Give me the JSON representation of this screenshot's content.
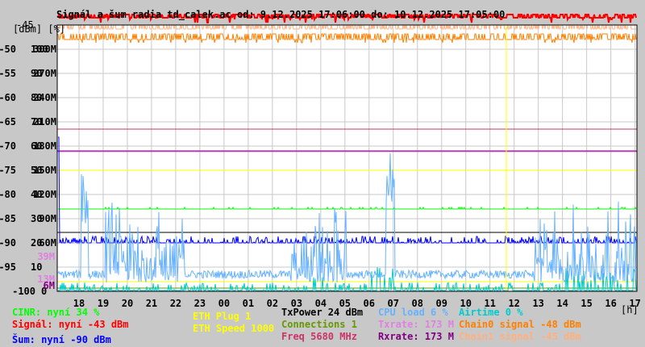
{
  "chart_data": {
    "type": "line",
    "title": "Signál a šum radia td_calek.ac od: 9.12.2025 17:06:00 do: 10.12.2025 17:05:00",
    "ylabel": "[dBm] [%]",
    "y_top_label": "-45",
    "xunit": "[h]",
    "xlim": [
      17.1,
      41.08
    ],
    "x_ticks": [
      "18",
      "19",
      "20",
      "21",
      "22",
      "23",
      "00",
      "01",
      "02",
      "03",
      "04",
      "05",
      "06",
      "07",
      "08",
      "09",
      "10",
      "11",
      "12",
      "13",
      "14",
      "15",
      "16",
      "17"
    ],
    "y_axes": {
      "dbm": {
        "range": [
          -100,
          -45
        ],
        "ticks": [
          "-50",
          "-55",
          "-60",
          "-65",
          "-70",
          "-75",
          "-80",
          "-85",
          "-90",
          "-95",
          "-100"
        ]
      },
      "percent": {
        "range": [
          0,
          110
        ],
        "ticks": [
          "100",
          "90",
          "80",
          "70",
          "60",
          "50",
          "40",
          "30",
          "20",
          "10",
          "0"
        ]
      },
      "rate": {
        "range": [
          0,
          330
        ],
        "ticks": [
          "300M",
          "270M",
          "240M",
          "210M",
          "180M",
          "150M",
          "120M",
          "90M",
          "60M"
        ]
      }
    },
    "extra_rate_labels": [
      {
        "text": "39M",
        "color": "#e080e0"
      },
      {
        "text": "13M",
        "color": "#e080e0"
      },
      {
        "text": "6M",
        "color": "#800080"
      }
    ],
    "grid": true,
    "marker_hour": 11.75,
    "series": [
      {
        "name": "CINR",
        "current": 34,
        "unit": "%",
        "color": "#00ff00"
      },
      {
        "name": "Signál",
        "current": -43,
        "unit": "dBm",
        "color": "#ff0000"
      },
      {
        "name": "Šum",
        "current": -90,
        "unit": "dBm",
        "color": "#0000ff"
      },
      {
        "name": "ETH Plug",
        "current": 1,
        "color": "#ffff00"
      },
      {
        "name": "ETH Speed",
        "current": 1000,
        "color": "#ffff00"
      },
      {
        "name": "TxPower",
        "current": 24,
        "unit": "dBm",
        "color": "#000000"
      },
      {
        "name": "Connections",
        "current": 1,
        "color": "#669900"
      },
      {
        "name": "Freq",
        "current": 5680,
        "unit": "MHz",
        "color": "#cc3366"
      },
      {
        "name": "CPU load",
        "current": 6,
        "unit": "%",
        "color": "#66b2ff"
      },
      {
        "name": "Txrate",
        "current": 173,
        "unit": "M",
        "color": "#e080e0"
      },
      {
        "name": "Rxrate",
        "current": 173,
        "unit": "M",
        "color": "#800080"
      },
      {
        "name": "Airtime",
        "current": 0,
        "unit": "%",
        "color": "#00cccc"
      },
      {
        "name": "Chain0 signal",
        "current": -48,
        "unit": "dBm",
        "color": "#ff8000"
      },
      {
        "name": "Chain1 signal",
        "current": -45,
        "unit": "dBm",
        "color": "#ffb080"
      }
    ]
  },
  "legend": {
    "cinr": "CINR: nyní 34 %",
    "signal": "Signál: nyní -43 dBm",
    "noise": "Šum: nyní -90 dBm",
    "eth_plug": "ETH Plug 1",
    "eth_speed": "ETH Speed 1000",
    "txpower": "TxPower 24 dBm",
    "connections": "Connections 1",
    "freq": "Freq 5680 MHz",
    "cpu": "CPU load 6 %",
    "txrate": "Txrate: 173 M",
    "rxrate": "Rxrate: 173 M",
    "airtime": "Airtime 0 %",
    "chain0": "Chain0 signal -48 dBm",
    "chain1": "Chain1 signal -45 dBm"
  }
}
